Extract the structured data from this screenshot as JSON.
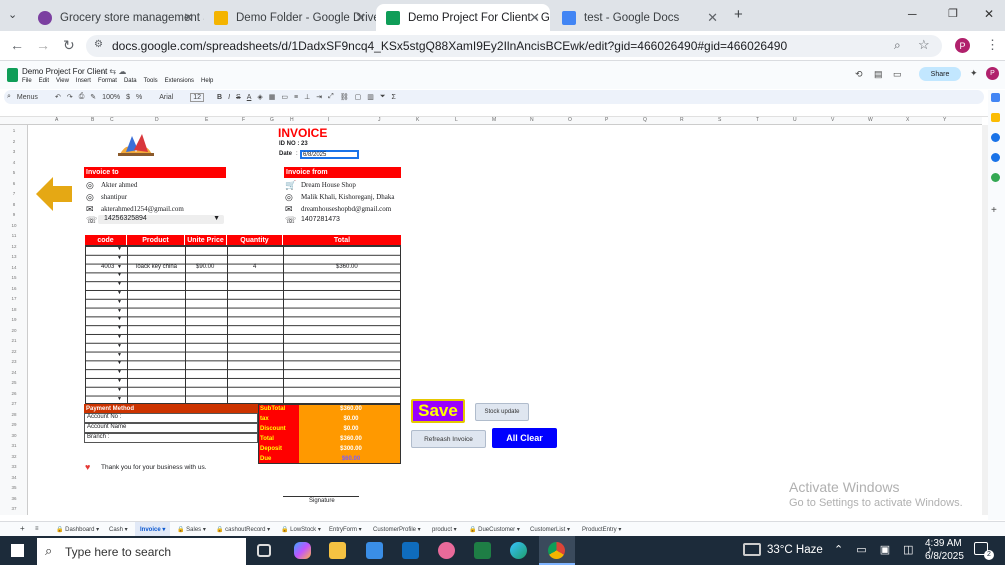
{
  "browser": {
    "tabs": [
      {
        "title": "Grocery store management Sp",
        "color": "#7b3fa0"
      },
      {
        "title": "Demo Folder - Google Drive",
        "color": "#f4b400"
      },
      {
        "title": "Demo Project For Client - Goog",
        "color": "#0f9d58"
      },
      {
        "title": "test - Google Docs",
        "color": "#4285f4"
      }
    ],
    "url": "docs.google.com/spreadsheets/d/1DadxSF9ncq4_KSx5stgQ88XamI9Ey2IlnAncisBCEwk/edit?gid=466026490#gid=466026490",
    "profile_letter": "P"
  },
  "sheets": {
    "doc_title": "Demo Project For Client",
    "menu": [
      "File",
      "Edit",
      "View",
      "Insert",
      "Format",
      "Data",
      "Tools",
      "Extensions",
      "Help"
    ],
    "share_label": "Share",
    "toolbar": {
      "search": "Menus",
      "zoom": "100%",
      "font": "Arial",
      "font_size": "12"
    },
    "columns": [
      "A",
      "B",
      "C",
      "D",
      "E",
      "F",
      "G",
      "H",
      "I",
      "J",
      "K",
      "L",
      "M",
      "N",
      "O",
      "P",
      "Q",
      "R",
      "S",
      "T",
      "U",
      "V",
      "W",
      "X",
      "Y"
    ]
  },
  "invoice": {
    "title": "INVOICE",
    "id_label": "ID NO :",
    "id_value": "23",
    "date_label": "Date",
    "date_value": "6/8/2025",
    "to_header": "Invoice to",
    "to_name": "Akter ahmed",
    "to_address": "shantipur",
    "to_email": "akterahmed1254@gmail.com",
    "to_phone": "14256325894",
    "from_header": "Invoice from",
    "from_shop": "Dream House Shop",
    "from_address": "Malik Khali, Kishoreganj, Dhaka",
    "from_email": "dreamhouseshopbd@gmail.com",
    "from_phone": "1407281473",
    "col_code": "code",
    "col_product": "Product",
    "col_unit_price": "Unite Price",
    "col_quantity": "Quantity",
    "col_total": "Total",
    "row_code": "4003",
    "row_product": "loack key china",
    "row_price": "$90.00",
    "row_qty": "4",
    "row_total": "$360.00",
    "payment_method": "Payment Method",
    "account_no": "Account No :",
    "account_name": "Account Name",
    "branch": "Branch :",
    "subtotal_label": "SubTotal",
    "subtotal_value": "$360.00",
    "tax_label": "tax",
    "tax_value": "$0.00",
    "discount_label": "Discount",
    "discount_value": "$0.00",
    "total_label": "Total",
    "total_value": "$360.00",
    "deposit_label": "Deposit",
    "deposit_value": "$300.00",
    "due_label": "Due",
    "due_value": "$60.00",
    "thanks": "Thank you for your business with us.",
    "signature": "Signature"
  },
  "buttons": {
    "save": "Save",
    "stock_update": "Stock update",
    "refresh": "Refreash Invoice",
    "all_clear": "All Clear"
  },
  "sheet_tabs": [
    "Dashboard",
    "Cash",
    "Invoice",
    "Sales",
    "cashoutRecord",
    "LowStock",
    "EntryForm",
    "CustomerProfile",
    "product",
    "DueCustomer",
    "CustomerList",
    "ProductEntry"
  ],
  "watermark": {
    "line1": "Activate Windows",
    "line2": "Go to Settings to activate Windows."
  },
  "taskbar": {
    "search_placeholder": "Type here to search",
    "weather": "33°C Haze",
    "time": "4:39 AM",
    "date": "6/8/2025",
    "notif_count": "2"
  },
  "colors": {
    "red": "#ff0000",
    "orange": "#ff9900",
    "darkred": "#cc3300",
    "save_bg": "#9900ff",
    "save_text": "#ffff00",
    "blue": "#0000ff"
  }
}
